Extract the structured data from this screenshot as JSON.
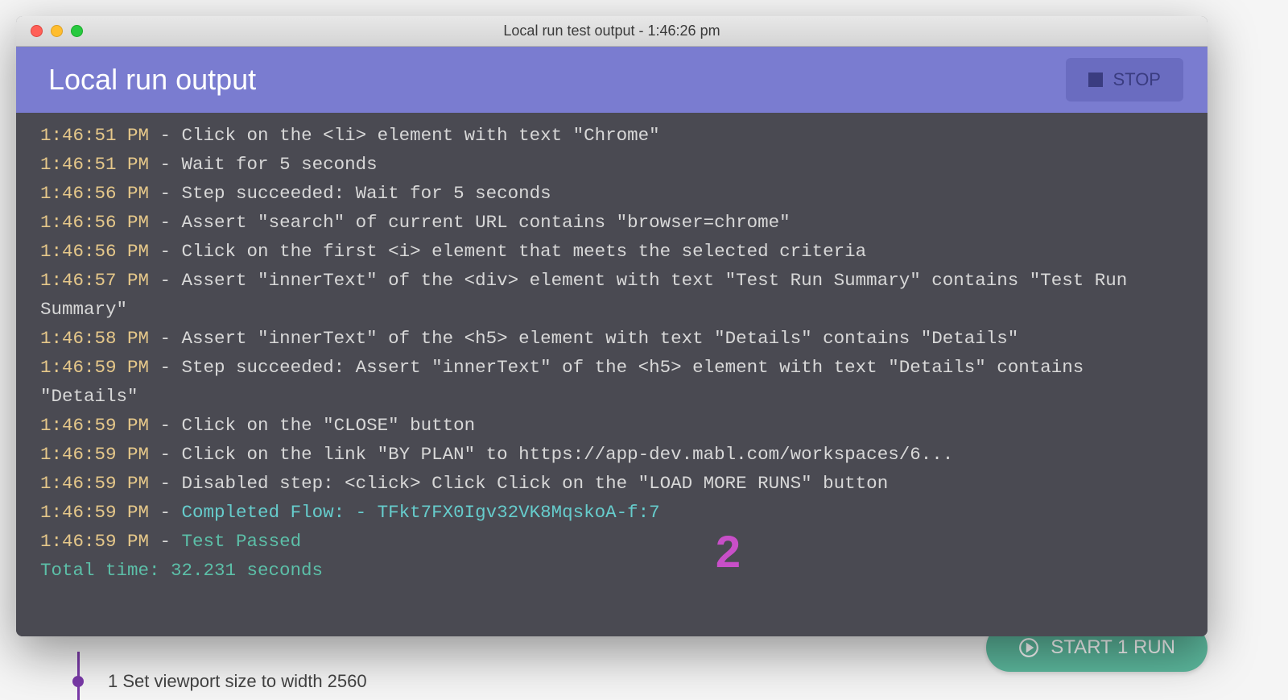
{
  "titlebar": {
    "title": "Local run test output - 1:46:26 pm"
  },
  "header": {
    "title": "Local run output",
    "stop_label": "STOP"
  },
  "logs": [
    {
      "ts": "1:46:51 PM",
      "msg": "Click on the <li> element with text \"Chrome\"",
      "style": "msg"
    },
    {
      "ts": "1:46:51 PM",
      "msg": "Wait for 5 seconds",
      "style": "msg"
    },
    {
      "ts": "1:46:56 PM",
      "msg": "Step succeeded: Wait for 5 seconds",
      "style": "msg"
    },
    {
      "ts": "1:46:56 PM",
      "msg": "Assert \"search\" of current URL contains \"browser=chrome\"",
      "style": "msg"
    },
    {
      "ts": "1:46:56 PM",
      "msg": "Click on the first <i> element that meets the selected criteria",
      "style": "msg"
    },
    {
      "ts": "1:46:57 PM",
      "msg": "Assert \"innerText\" of the <div> element with text \"Test Run Summary\" contains \"Test Run Summary\"",
      "style": "msg"
    },
    {
      "ts": "1:46:58 PM",
      "msg": "Assert \"innerText\" of the <h5> element with text \"Details\" contains \"Details\"",
      "style": "msg"
    },
    {
      "ts": "1:46:59 PM",
      "msg": "Step succeeded: Assert \"innerText\" of the <h5> element with text \"Details\" contains \"Details\"",
      "style": "msg"
    },
    {
      "ts": "1:46:59 PM",
      "msg": "Click on the \"CLOSE\" button",
      "style": "msg"
    },
    {
      "ts": "1:46:59 PM",
      "msg": "Click on the link \"BY PLAN\" to https://app-dev.mabl.com/workspaces/6...",
      "style": "msg"
    },
    {
      "ts": "1:46:59 PM",
      "msg": "Disabled step: <click> Click Click on the \"LOAD MORE RUNS\" button",
      "style": "msg"
    },
    {
      "ts": "1:46:59 PM",
      "msg": "Completed Flow: - TFkt7FX0Igv32VK8MqskoA-f:7",
      "style": "msg-cyan"
    },
    {
      "ts": "1:46:59 PM",
      "msg": "Test Passed",
      "style": "msg-teal"
    }
  ],
  "total_time": "Total time: 32.231 seconds",
  "annotation": "2",
  "background": {
    "start_run_label": "START 1 RUN",
    "step_text": "1  Set viewport size to width 2560"
  }
}
